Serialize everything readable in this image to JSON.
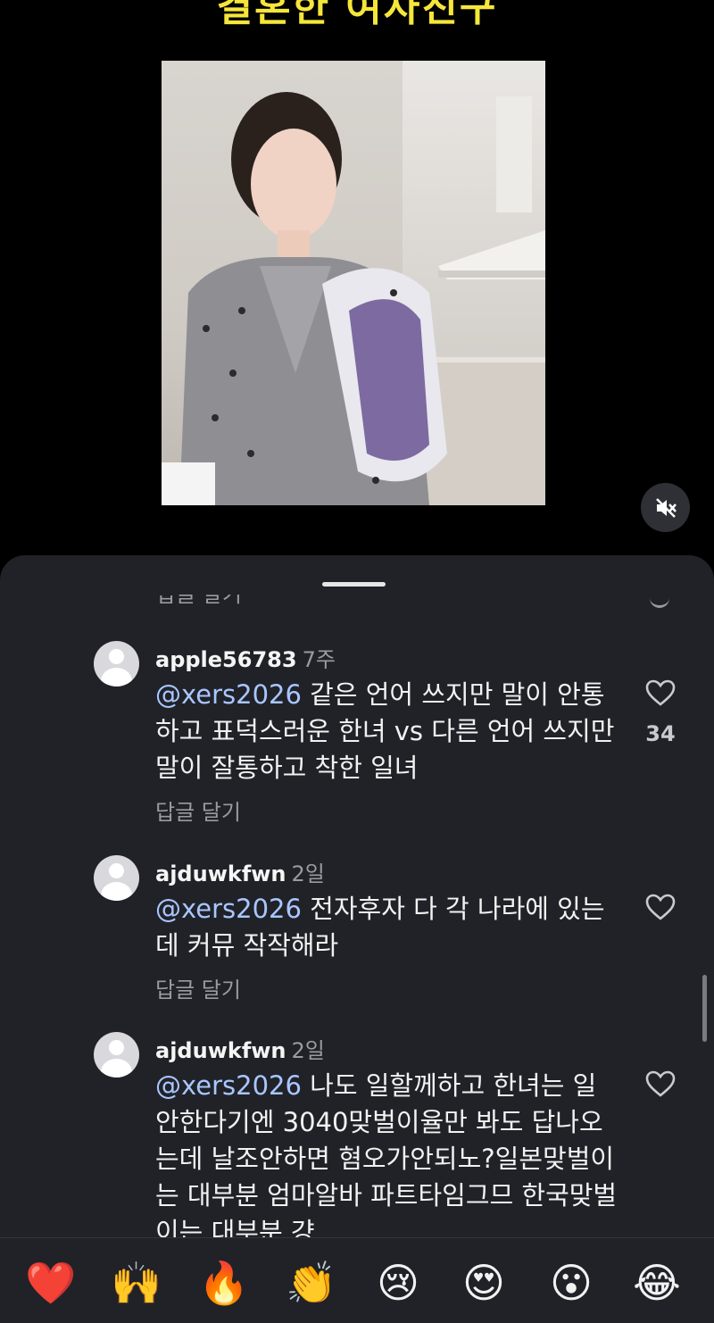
{
  "video": {
    "title": "결혼한 여자친구"
  },
  "comments_sheet": {
    "truncated_reply_label": "답글 달기",
    "comments": [
      {
        "username": "apple56783",
        "time": "7주",
        "mention": "@xers2026",
        "text": " 같은 언어 쓰지만 말이 안통하고 표덕스러운 한녀 vs 다른 언어 쓰지만 말이 잘통하고 착한 일녀",
        "reply_label": "답글 달기",
        "like_count": "34"
      },
      {
        "username": "ajduwkfwn",
        "time": "2일",
        "mention": "@xers2026",
        "text": " 전자후자 다 각 나라에 있는데 커뮤 작작해라",
        "reply_label": "답글 달기",
        "like_count": ""
      },
      {
        "username": "ajduwkfwn",
        "time": "2일",
        "mention": "@xers2026",
        "text": " 나도 일할께하고 한녀는 일 안한다기엔 3040맞벌이율만 봐도 답나오는데 날조안하면 혐오가안되노?일본맞벌이는 대부분 엄마알바 파트타임그므 한국맞벌이는 대부분 걍",
        "reply_label": "",
        "like_count": ""
      }
    ]
  },
  "emoji_bar": {
    "emojis": [
      "❤️",
      "🙌",
      "🔥",
      "👏",
      "😢",
      "😍",
      "😮",
      "😂"
    ]
  },
  "icons": {
    "mute": "speaker-muted-icon",
    "like": "heart-outline-icon"
  }
}
